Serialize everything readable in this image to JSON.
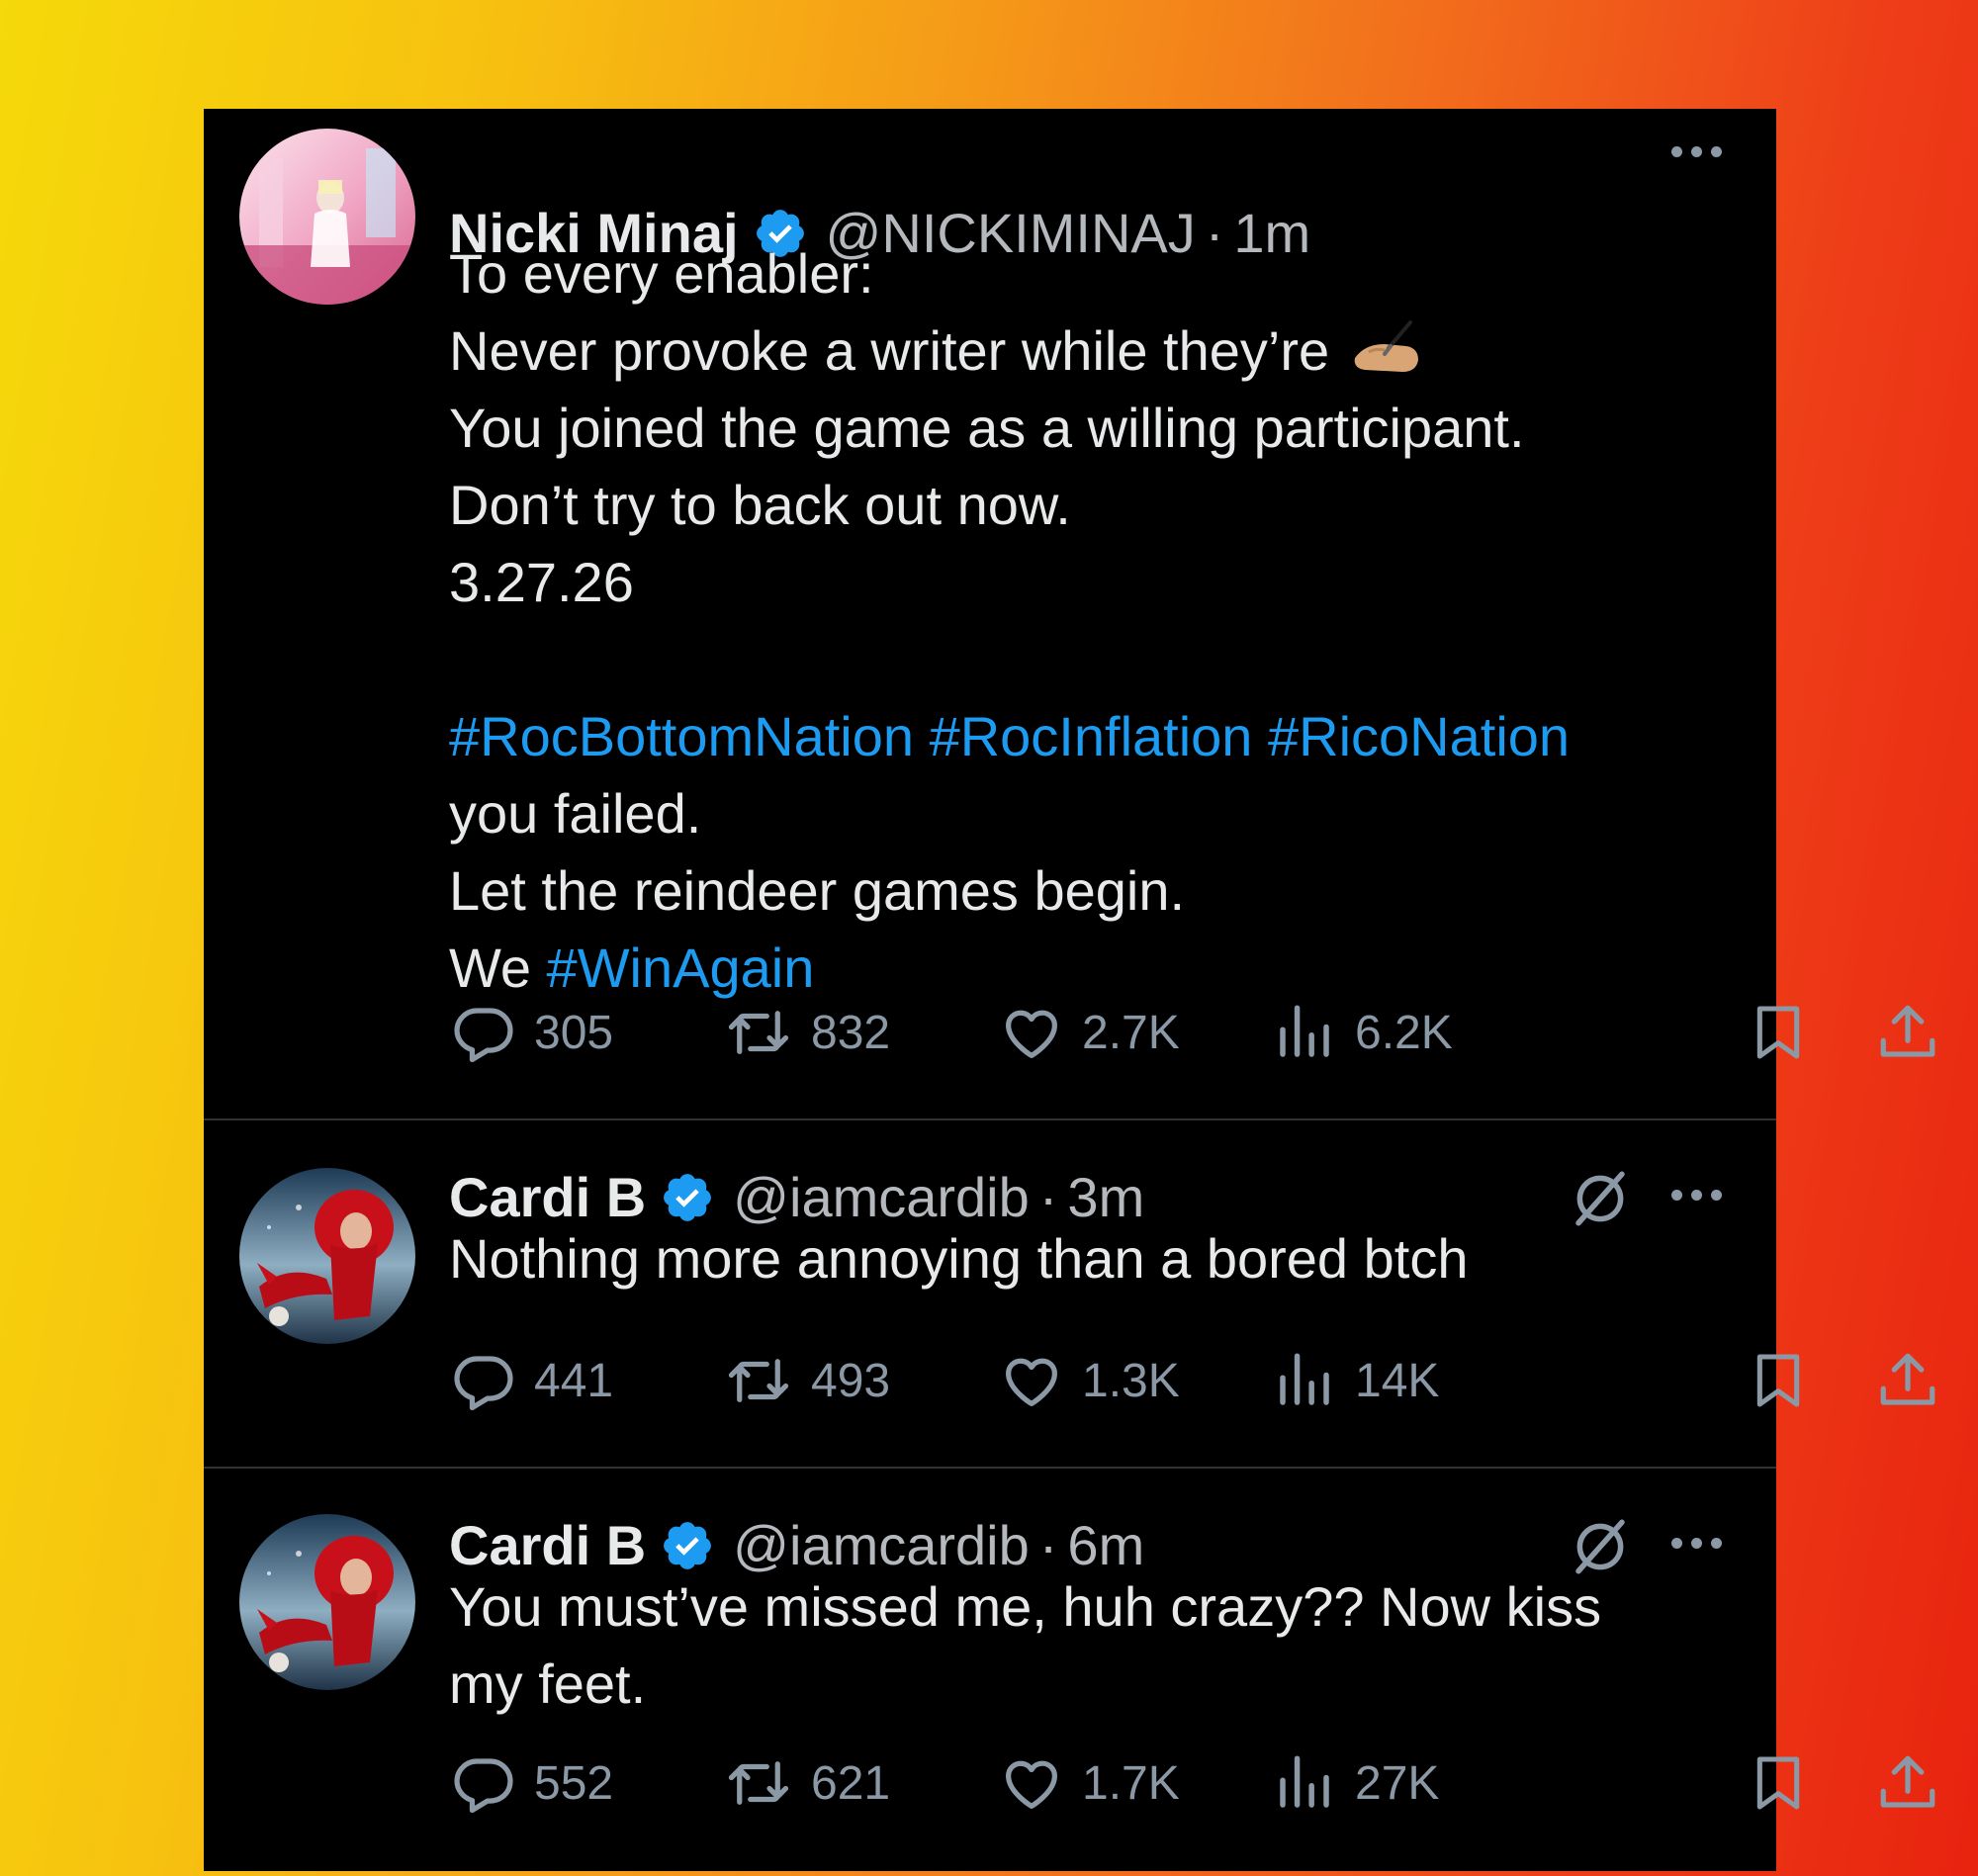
{
  "tweets": [
    {
      "name": "Nicki Minaj",
      "handle": "@NICKIMINAJ",
      "separator": "·",
      "time": "1m",
      "lines": [
        {
          "parts": [
            {
              "text": "To every enabler:"
            }
          ]
        },
        {
          "parts": [
            {
              "text": "Never provoke a writer while they’re "
            },
            {
              "emoji": "writing-hand"
            }
          ]
        },
        {
          "parts": [
            {
              "text": "You joined the game as a willing participant."
            }
          ]
        },
        {
          "parts": [
            {
              "text": "Don’t try to back out now."
            }
          ]
        },
        {
          "parts": [
            {
              "text": "3.27.26"
            }
          ]
        },
        {
          "parts": []
        },
        {
          "parts": [
            {
              "text": "#RocBottomNation #RocInflation #RicoNation",
              "hashtag": true
            }
          ]
        },
        {
          "parts": [
            {
              "text": "you failed."
            }
          ]
        },
        {
          "parts": [
            {
              "text": "Let the reindeer games begin."
            }
          ]
        },
        {
          "parts": [
            {
              "text": "We "
            },
            {
              "text": "#WinAgain",
              "hashtag": true
            }
          ]
        }
      ],
      "replies": "305",
      "reposts": "832",
      "likes": "2.7K",
      "views": "6.2K"
    },
    {
      "name": "Cardi B",
      "handle": "@iamcardib",
      "separator": "·",
      "time": "3m",
      "lines": [
        {
          "parts": [
            {
              "text": "Nothing more annoying than a bored btch"
            }
          ]
        }
      ],
      "replies": "441",
      "reposts": "493",
      "likes": "1.3K",
      "views": "14K"
    },
    {
      "name": "Cardi B",
      "handle": "@iamcardib",
      "separator": "·",
      "time": "6m",
      "lines": [
        {
          "parts": [
            {
              "text": "You must’ve missed me, huh crazy?? Now kiss"
            }
          ]
        },
        {
          "parts": [
            {
              "text": "my feet."
            }
          ]
        }
      ],
      "replies": "552",
      "reposts": "621",
      "likes": "1.7K",
      "views": "27K"
    }
  ],
  "colors": {
    "hashtag": "#1d9bf0",
    "verified": "#1d9bf0",
    "panel": "#000000",
    "metric": "#8b98a5"
  },
  "icons": [
    "verified-badge-icon",
    "more-options-icon",
    "muted-notifications-icon",
    "reply-icon",
    "repost-icon",
    "like-icon",
    "views-icon",
    "bookmark-icon",
    "share-icon",
    "writing-hand-emoji"
  ]
}
